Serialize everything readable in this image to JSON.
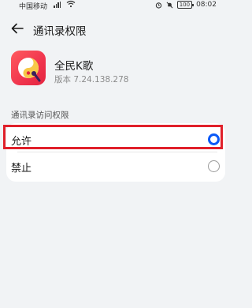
{
  "status_bar": {
    "carrier": "中国移动",
    "network_type": "ₐ",
    "battery": "100",
    "time": "08:02"
  },
  "header": {
    "title": "通讯录权限"
  },
  "app": {
    "name": "全民K歌",
    "version": "版本 7.24.138.278",
    "icon_colors": [
      "#ff5a5f",
      "#e4243f"
    ]
  },
  "section": {
    "label": "通讯录访问权限"
  },
  "options": [
    {
      "label": "允许",
      "selected": true
    },
    {
      "label": "禁止",
      "selected": false
    }
  ],
  "colors": {
    "accent": "#0a59f7",
    "highlight": "#e0202a",
    "background": "#f1f3f5"
  }
}
